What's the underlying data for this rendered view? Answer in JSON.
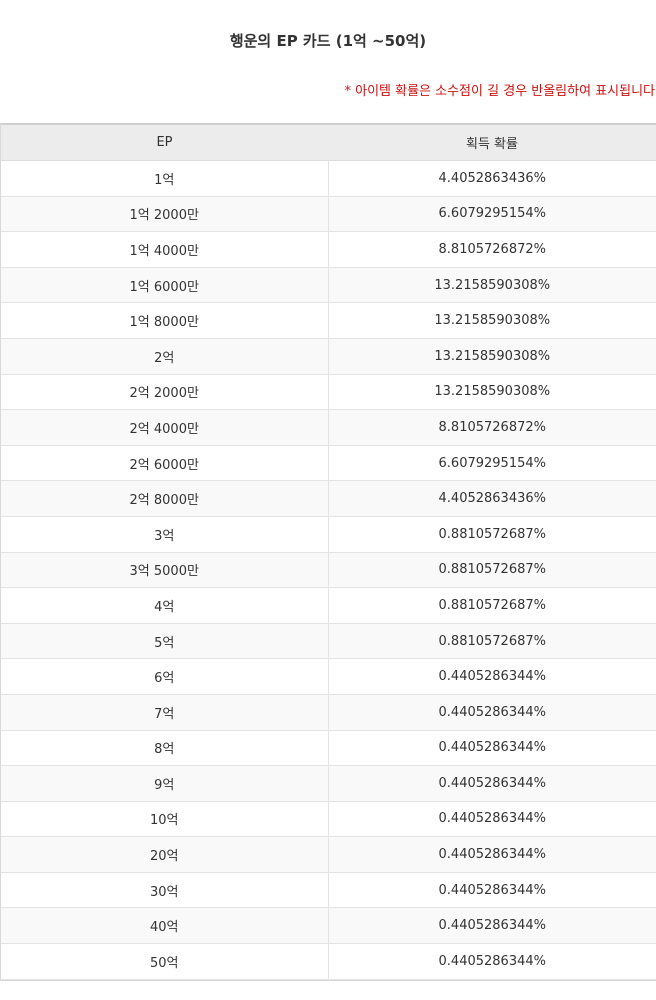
{
  "title": "행운의 EP 카드 (1억 ~50억)",
  "notice": "* 아이템 확률은 소수점이 길 경우 반올림하여 표시됩니다",
  "table": {
    "headers": [
      "EP",
      "획득 확률"
    ],
    "rows": [
      [
        "1억",
        "4.4052863436%"
      ],
      [
        "1억 2000만",
        "6.6079295154%"
      ],
      [
        "1억 4000만",
        "8.8105726872%"
      ],
      [
        "1억 6000만",
        "13.2158590308%"
      ],
      [
        "1억 8000만",
        "13.2158590308%"
      ],
      [
        "2억",
        "13.2158590308%"
      ],
      [
        "2억 2000만",
        "13.2158590308%"
      ],
      [
        "2억 4000만",
        "8.8105726872%"
      ],
      [
        "2억 6000만",
        "6.6079295154%"
      ],
      [
        "2억 8000만",
        "4.4052863436%"
      ],
      [
        "3억",
        "0.8810572687%"
      ],
      [
        "3억 5000만",
        "0.8810572687%"
      ],
      [
        "4억",
        "0.8810572687%"
      ],
      [
        "5억",
        "0.8810572687%"
      ],
      [
        "6억",
        "0.4405286344%"
      ],
      [
        "7억",
        "0.4405286344%"
      ],
      [
        "8억",
        "0.4405286344%"
      ],
      [
        "9억",
        "0.4405286344%"
      ],
      [
        "10억",
        "0.4405286344%"
      ],
      [
        "20억",
        "0.4405286344%"
      ],
      [
        "30억",
        "0.4405286344%"
      ],
      [
        "40억",
        "0.4405286344%"
      ],
      [
        "50억",
        "0.4405286344%"
      ]
    ]
  }
}
